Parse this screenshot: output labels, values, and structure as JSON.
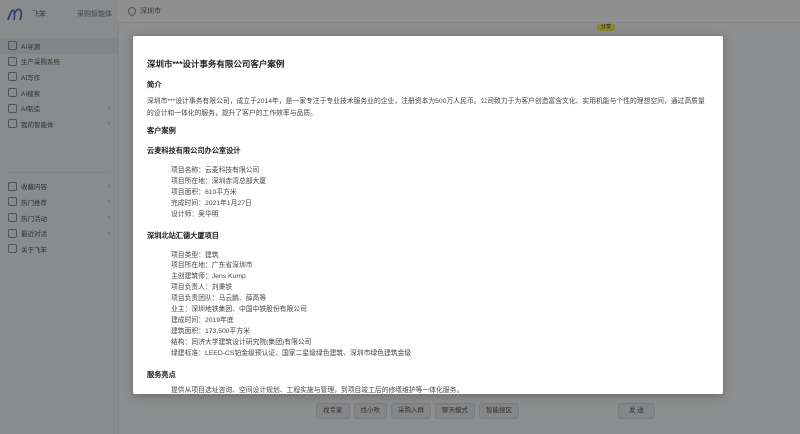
{
  "app": {
    "name": "飞笨",
    "subtitle": "采购智能体"
  },
  "sidebar": {
    "items": [
      {
        "label": "AI寻源",
        "chev": ""
      },
      {
        "label": "生产采购系统",
        "chev": ""
      },
      {
        "label": "AI写作",
        "chev": ""
      },
      {
        "label": "AI搜索",
        "chev": ""
      },
      {
        "label": "AI制造",
        "chev": "›"
      },
      {
        "label": "我的智能体",
        "chev": "›"
      }
    ],
    "items2": [
      {
        "label": "收藏内容",
        "chev": "›"
      },
      {
        "label": "热门推荐",
        "chev": "›"
      },
      {
        "label": "热门活动",
        "chev": "›"
      },
      {
        "label": "最近对话",
        "chev": "›"
      },
      {
        "label": "关于飞笨",
        "chev": ""
      }
    ]
  },
  "topbar": {
    "location": "深圳市"
  },
  "tag": "分享",
  "modal": {
    "title": "深圳市***设计事务有限公司客户案例",
    "intro_heading": "简介",
    "intro_text": "深圳市***设计事务有限公司，成立于2014年，是一家专注于专业技术服务业的企业，注册资本为500万人民币。公司致力于为客户创造富含文化、实用机能与个性的理想空间，通过高质量的设计和一体化的服务，提升了客户的工作效率与品质。",
    "cases_heading": "客户案例",
    "case1_title": "云麦科技有限公司办公室设计",
    "case1_lines": [
      "项目名称：云麦科技有限公司",
      "项目所在地：深圳赤湾总部大厦",
      "项目面积：610平方米",
      "完成时间：2021年1月27日",
      "设计师：吴华明"
    ],
    "case2_title": "深圳北站汇德大厦项目",
    "case2_lines": [
      "项目类型：建筑",
      "项目所在地：广东省深圳市",
      "主创建筑师：Jens Kump",
      "项目负责人：刘秉铁",
      "项目负责团队：马云鹏、薛高等",
      "业主：深圳地铁集团、中国中铁股份有限公司",
      "建成时间：2019年底",
      "建筑面积：173,500平方米",
      "结构：同济大学建筑设计研究院(集团)有限公司",
      "绿建标准：LEED-CS铂金级预认证、国家二星级绿色建筑、深圳市绿色建筑金级"
    ],
    "highlights_heading": "服务亮点",
    "highlights_text": "提供从项目选址咨询、空间设计规划、工程实施与管理，到项目竣工后的修缮维护等一体化服务。"
  },
  "bottom": {
    "buttons": [
      "找专家",
      "找小吹",
      "采购入群",
      "聊天模式",
      "智能搜区"
    ],
    "send": "发 送"
  }
}
